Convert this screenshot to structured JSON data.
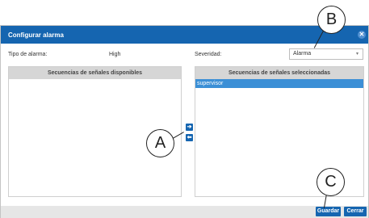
{
  "dialog": {
    "title": "Configurar alarma",
    "close_icon": "close-icon"
  },
  "form": {
    "tipo_label": "Tipo de alarma:",
    "tipo_value": "High",
    "severidad_label": "Severidad:",
    "severidad_selected": "Alarma",
    "severidad_caret_icon": "chevron-down-icon"
  },
  "available_panel": {
    "header": "Secuencias de señales disponibles",
    "items": []
  },
  "selected_panel": {
    "header": "Secuencias de señales seleccionadas",
    "items": [
      "supervisor"
    ]
  },
  "transfer": {
    "add_icon": "arrow-right-icon",
    "remove_icon": "arrow-left-icon"
  },
  "footer": {
    "save_label": "Guardar",
    "close_label": "Cerrar"
  },
  "callouts": {
    "a": "A",
    "b": "B",
    "c": "C"
  },
  "colors": {
    "accent": "#1565b0",
    "selection": "#3b8fd6"
  }
}
